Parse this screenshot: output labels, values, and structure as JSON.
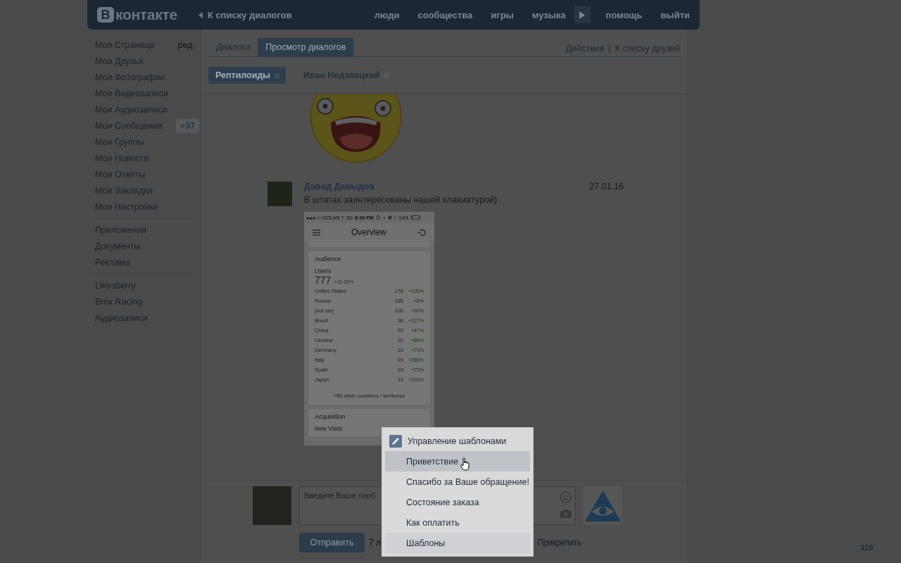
{
  "header": {
    "logo_letter": "В",
    "logo_text": "контакте",
    "back_link": "К списку диалогов",
    "nav": [
      {
        "kind": "link",
        "label": "люди"
      },
      {
        "kind": "link",
        "label": "сообщества"
      },
      {
        "kind": "link",
        "label": "игры"
      },
      {
        "kind": "link",
        "label": "музыка"
      },
      {
        "kind": "play"
      },
      {
        "kind": "link",
        "label": "помощь"
      },
      {
        "kind": "link",
        "label": "выйти"
      }
    ]
  },
  "sidebar": {
    "edit_link": "ред.",
    "sections": [
      {
        "items": [
          {
            "label": "Моя Страница"
          },
          {
            "label": "Мои Друзья"
          },
          {
            "label": "Мои Фотографии"
          },
          {
            "label": "Мои Видеозаписи"
          },
          {
            "label": "Мои Аудиозаписи"
          },
          {
            "label": "Мои Сообщения",
            "badge": "+37"
          },
          {
            "label": "Мои Группы"
          },
          {
            "label": "Мои Новости"
          },
          {
            "label": "Мои Ответы"
          },
          {
            "label": "Мои Закладки"
          },
          {
            "label": "Мои Настройки"
          }
        ]
      },
      {
        "items": [
          {
            "label": "Приложения"
          },
          {
            "label": "Документы"
          },
          {
            "label": "Реклама"
          }
        ]
      },
      {
        "items": [
          {
            "label": "Likesberry"
          },
          {
            "label": "Bmx Racing"
          },
          {
            "label": "Аудиозаписи"
          }
        ]
      }
    ]
  },
  "tabs": [
    {
      "label": "Диалоги",
      "selected": false
    },
    {
      "label": "Просмотр диалогов",
      "selected": true
    }
  ],
  "actions": {
    "items": [
      "Действия",
      "К списку друзей"
    ],
    "separator": "|"
  },
  "chat_tabs": [
    {
      "label": "Рептилоиды",
      "selected": true
    },
    {
      "label": "Иван Недзвецкий",
      "selected": false
    }
  ],
  "messages": [
    {
      "kind": "sticker"
    },
    {
      "kind": "text",
      "author": "Давид Давыдов",
      "date": "27.01.16",
      "text": "В штатах заинтересованы нашей клавиатурой)",
      "attachment": {
        "status_bar": {
          "carrier": "●●●○○ GOLAN T",
          "network": "3G",
          "time": "6:49 PM",
          "battery": "14%"
        },
        "title": "Overview",
        "card_title": "Audience",
        "metric_label": "Users",
        "metric_value": "777",
        "metric_change": "+43.09%",
        "rows": [
          {
            "name": "United States",
            "value": "176",
            "change": "+105%"
          },
          {
            "name": "Russia",
            "value": "165",
            "change": "+8%"
          },
          {
            "name": "(not set)",
            "value": "100",
            "change": "+30%"
          },
          {
            "name": "Brazil",
            "value": "36",
            "change": "+227%"
          },
          {
            "name": "China",
            "value": "22",
            "change": "+47%"
          },
          {
            "name": "Ukraine",
            "value": "22",
            "change": "+60%"
          },
          {
            "name": "Germany",
            "value": "19",
            "change": "+73%"
          },
          {
            "name": "Italy",
            "value": "19",
            "change": "+280%"
          },
          {
            "name": "Spain",
            "value": "19",
            "change": "+73%"
          },
          {
            "name": "Japan",
            "value": "13",
            "change": "+333%"
          }
        ],
        "footer": "+59 other countries / territories",
        "next_card_title": "Acquisition",
        "next_metric": "New Visits"
      }
    }
  ],
  "compose": {
    "placeholder": "Введите Ваше сооб",
    "send_button": "Отправить",
    "counter": "7 л",
    "attach_link": "Прикрепить"
  },
  "template_menu": {
    "manage": "Управление шаблонами",
    "items": [
      {
        "label": "Приветствие",
        "selected": true
      },
      {
        "label": "Спасибо за Ваше обращение!",
        "selected": false
      },
      {
        "label": "Состояние заказа",
        "selected": false
      },
      {
        "label": "Как оплатить",
        "selected": false
      }
    ],
    "toggle": "Шаблоны"
  },
  "corner_counter": "310"
}
